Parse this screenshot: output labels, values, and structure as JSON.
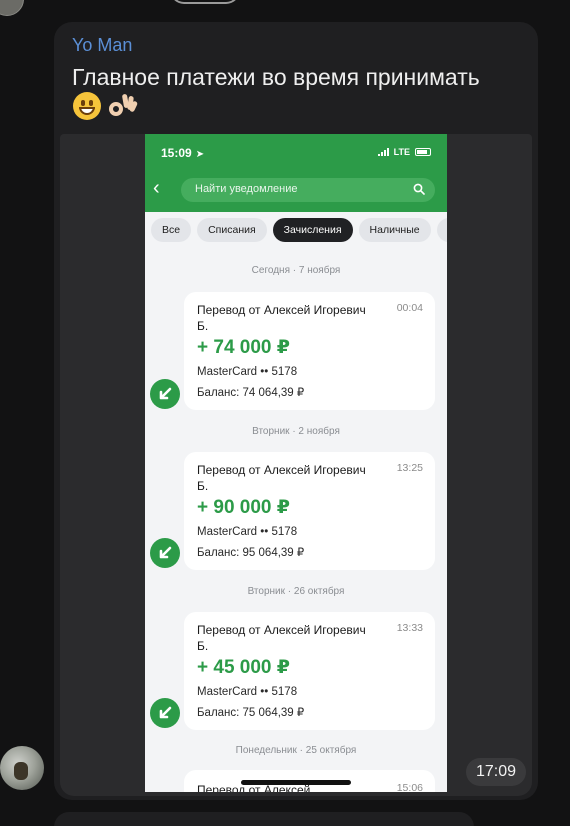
{
  "message": {
    "sender": "Yo Man",
    "text": "Главное платежи во время принимать",
    "emojis": [
      "grinning-face",
      "ok-hand"
    ],
    "time": "17:09"
  },
  "phone": {
    "status_time": "15:09",
    "network": "LTE",
    "search_placeholder": "Найти уведомление",
    "filters": [
      {
        "label": "Все",
        "active": false
      },
      {
        "label": "Списания",
        "active": false
      },
      {
        "label": "Зачисления",
        "active": true
      },
      {
        "label": "Наличные",
        "active": false
      },
      {
        "label": "П",
        "active": false
      }
    ],
    "groups": [
      {
        "date": "Сегодня · 7 ноября",
        "title": "Перевод от Алексей Игоревич Б.",
        "time": "00:04",
        "amount": "+ 74 000 ₽",
        "account": "MasterCard •• 5178",
        "balance": "Баланс: 74 064,39 ₽"
      },
      {
        "date": "Вторник · 2 ноября",
        "title": "Перевод от Алексей Игоревич Б.",
        "time": "13:25",
        "amount": "+ 90 000 ₽",
        "account": "MasterCard •• 5178",
        "balance": "Баланс: 95 064,39 ₽"
      },
      {
        "date": "Вторник · 26 октября",
        "title": "Перевод от Алексей Игоревич Б.",
        "time": "13:33",
        "amount": "+ 45 000 ₽",
        "account": "MasterCard •• 5178",
        "balance": "Баланс: 75 064,39 ₽"
      }
    ],
    "partial": {
      "date": "Понедельник · 25 октября",
      "title": "Перевод от Алексей",
      "time": "15:06"
    }
  },
  "colors": {
    "sber_green": "#2c9b48",
    "sender_blue": "#5b8fd6",
    "bubble_bg": "#1f1f21",
    "app_bg": "#121213"
  }
}
